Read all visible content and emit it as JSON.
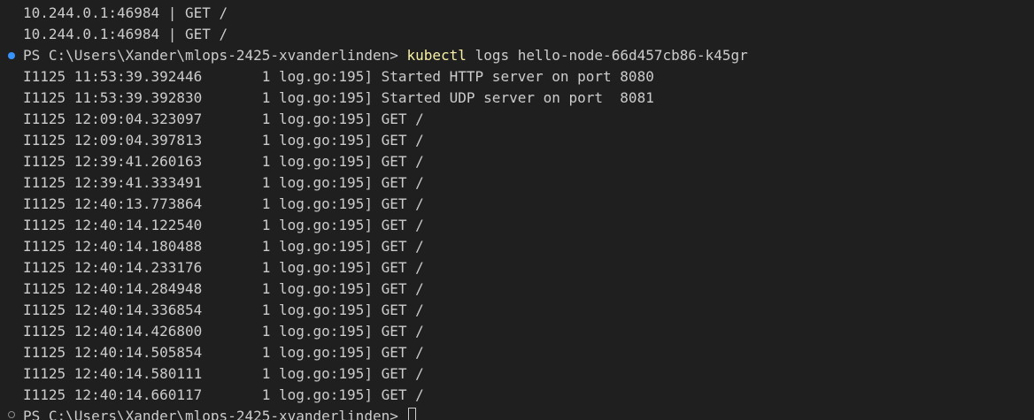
{
  "terminal": {
    "pre_lines": [
      "10.244.0.1:46984 | GET /",
      "10.244.0.1:46984 | GET /"
    ],
    "prompt1": {
      "ps": "PS C:\\Users\\Xander\\mlops-2425-xvanderlinden>",
      "command": "kubectl",
      "args": "logs hello-node-66d457cb86-k45gr"
    },
    "log_lines": [
      "I1125 11:53:39.392446       1 log.go:195] Started HTTP server on port 8080",
      "I1125 11:53:39.392830       1 log.go:195] Started UDP server on port  8081",
      "I1125 12:09:04.323097       1 log.go:195] GET /",
      "I1125 12:09:04.397813       1 log.go:195] GET /",
      "I1125 12:39:41.260163       1 log.go:195] GET /",
      "I1125 12:39:41.333491       1 log.go:195] GET /",
      "I1125 12:40:13.773864       1 log.go:195] GET /",
      "I1125 12:40:14.122540       1 log.go:195] GET /",
      "I1125 12:40:14.180488       1 log.go:195] GET /",
      "I1125 12:40:14.233176       1 log.go:195] GET /",
      "I1125 12:40:14.284948       1 log.go:195] GET /",
      "I1125 12:40:14.336854       1 log.go:195] GET /",
      "I1125 12:40:14.426800       1 log.go:195] GET /",
      "I1125 12:40:14.505854       1 log.go:195] GET /",
      "I1125 12:40:14.580111       1 log.go:195] GET /",
      "I1125 12:40:14.660117       1 log.go:195] GET /"
    ],
    "prompt2": {
      "ps": "PS C:\\Users\\Xander\\mlops-2425-xvanderlinden>"
    },
    "colors": {
      "background": "#1f1f1f",
      "text": "#cccccc",
      "command": "#f9f1a5",
      "decoration_success": "#3794ff"
    }
  }
}
